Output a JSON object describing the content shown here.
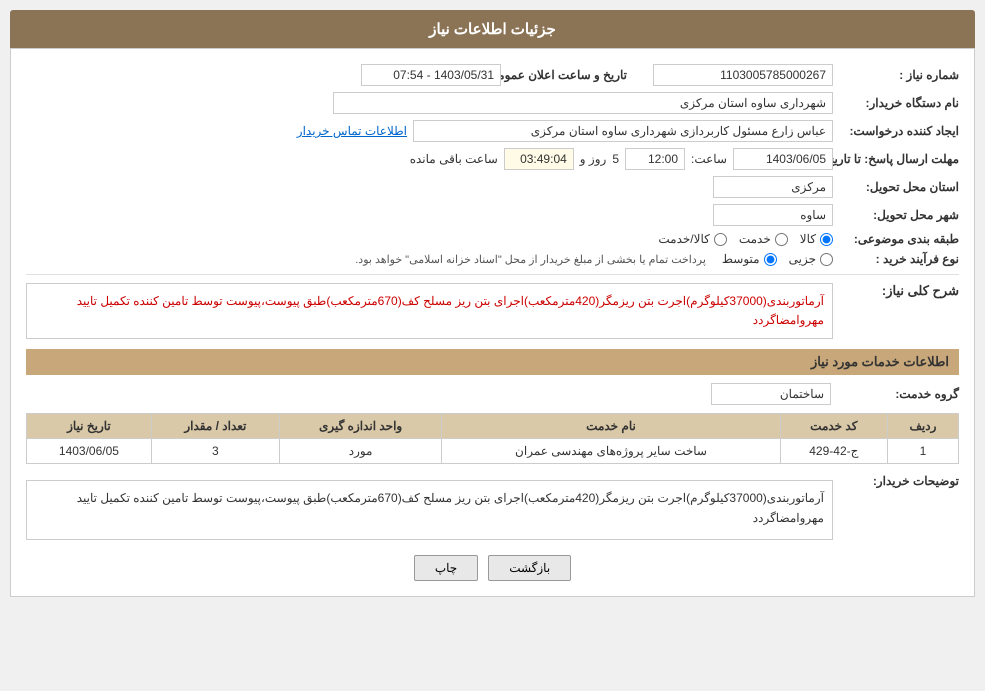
{
  "header": {
    "title": "جزئیات اطلاعات نیاز"
  },
  "fields": {
    "shomara_niaz_label": "شماره نیاز :",
    "shomara_niaz_value": "1103005785000267",
    "tarikh_label": "تاریخ و ساعت اعلان عمومی:",
    "tarikh_value": "1403/05/31 - 07:54",
    "nam_dastgah_label": "نام دستگاه خریدار:",
    "nam_dastgah_value": "شهرداری ساوه استان مرکزی",
    "ijad_label": "ایجاد کننده درخواست:",
    "ijad_value": "عباس زارع مسئول کاربردازی شهرداری ساوه استان مرکزی",
    "ijad_link": "اطلاعات تماس خریدار",
    "mohlat_label": "مهلت ارسال پاسخ: تا تاریخ:",
    "mohlat_date": "1403/06/05",
    "mohlat_saat_label": "ساعت:",
    "mohlat_saat": "12:00",
    "mohlat_rooz_label": "روز و",
    "mohlat_rooz": "5",
    "mohlat_baqi": "03:49:04",
    "mohlat_baqi_label": "ساعت باقی مانده",
    "ostan_label": "استان محل تحویل:",
    "ostan_value": "مرکزی",
    "shahr_label": "شهر محل تحویل:",
    "shahr_value": "ساوه",
    "tabaqeh_label": "طبقه بندی موضوعی:",
    "tabaqeh_options": [
      "کالا",
      "خدمت",
      "کالا/خدمت"
    ],
    "tabaqeh_selected": "کالا",
    "nooe_farayand_label": "نوع فرآیند خرید :",
    "nooe_options": [
      "جزیی",
      "متوسط"
    ],
    "nooe_selected": "متوسط",
    "nooe_note": "پرداخت تمام یا بخشی از مبلغ خریدار از محل \"اسناد خزانه اسلامی\" خواهد بود.",
    "sharh_label": "شرح کلی نیاز:",
    "sharh_value": "آرماتوربندی(37000کیلوگرم)اجرت بتن ریزمگر(420مترمکعب)اجرای بتن ریز مسلح کف(670مترمکعب)طبق پیوست،پیوست توسط تامین کننده تکمیل تایید مهروامضاگردد",
    "khadamat_label": "اطلاعات خدمات مورد نیاز",
    "goroh_label": "گروه خدمت:",
    "goroh_value": "ساختمان",
    "table": {
      "headers": [
        "ردیف",
        "کد خدمت",
        "نام خدمت",
        "واحد اندازه گیری",
        "تعداد / مقدار",
        "تاریخ نیاز"
      ],
      "rows": [
        {
          "radif": "1",
          "kod": "ج-42-429",
          "nam": "ساخت سایر پروژه‌های مهندسی عمران",
          "vahed": "مورد",
          "tedad": "3",
          "tarikh": "1403/06/05"
        }
      ]
    },
    "tawzih_label": "توضیحات خریدار:",
    "tawzih_value": "آرماتوربندی(37000کیلوگرم)اجرت بتن ریزمگر(420مترمکعب)اجرای بتن ریز مسلح کف(670مترمکعب)طبق پیوست،پیوست توسط تامین کننده تکمیل تایید مهروامضاگردد",
    "btn_chap": "چاپ",
    "btn_bazgasht": "بازگشت"
  }
}
